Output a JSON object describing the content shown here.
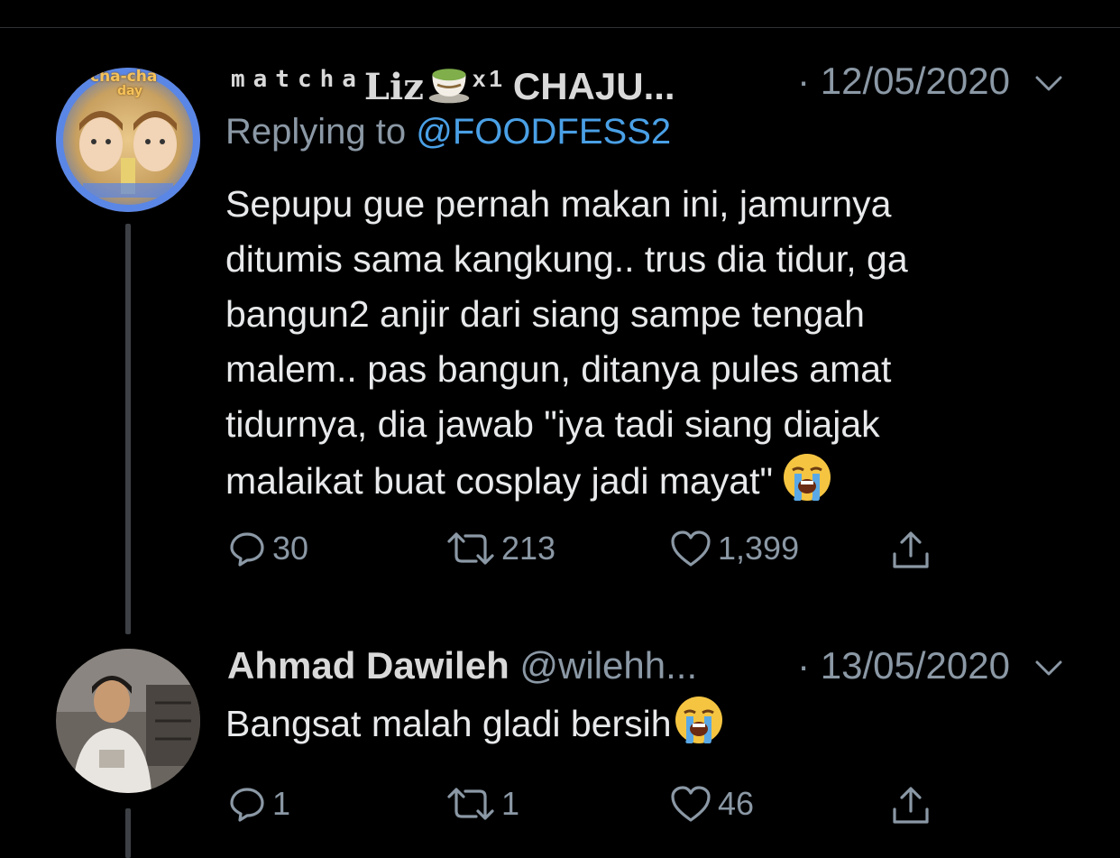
{
  "tweets": [
    {
      "name_prefix": "matcha",
      "name_main": "Liz",
      "name_sup": "x1",
      "name_suffix": "CHAJU...",
      "date": "12/05/2020",
      "replying_label": "Replying to",
      "replying_handle": "@FOODFESS2",
      "text": "Sepupu gue pernah makan ini, jamurnya\nditumis sama kangkung.. trus dia tidur, ga\nbangun2 anjir dari siang sampe tengah\nmalem.. pas bangun, ditanya pules amat\ntidurnya, dia jawab \"iya tadi siang diajak\nmalaikat buat cosplay jadi mayat\"",
      "avatar_text": [
        "cha-cha",
        "day"
      ],
      "replies": "30",
      "retweets": "213",
      "likes": "1,399"
    },
    {
      "name": "Ahmad Dawileh",
      "handle": "@wilehh...",
      "date": "13/05/2020",
      "text": "Bangsat malah gladi bersih",
      "replies": "1",
      "retweets": "1",
      "likes": "46"
    }
  ],
  "colors": {
    "background": "#000000",
    "text": "#e7e9ea",
    "secondary": "#8b98a5",
    "link": "#4aa0e6",
    "thread_line": "#3d4145"
  },
  "icons": [
    "reply-icon",
    "retweet-icon",
    "like-icon",
    "share-icon",
    "chevron-down-icon",
    "loudly-crying-face-emoji",
    "teacup-emoji"
  ]
}
